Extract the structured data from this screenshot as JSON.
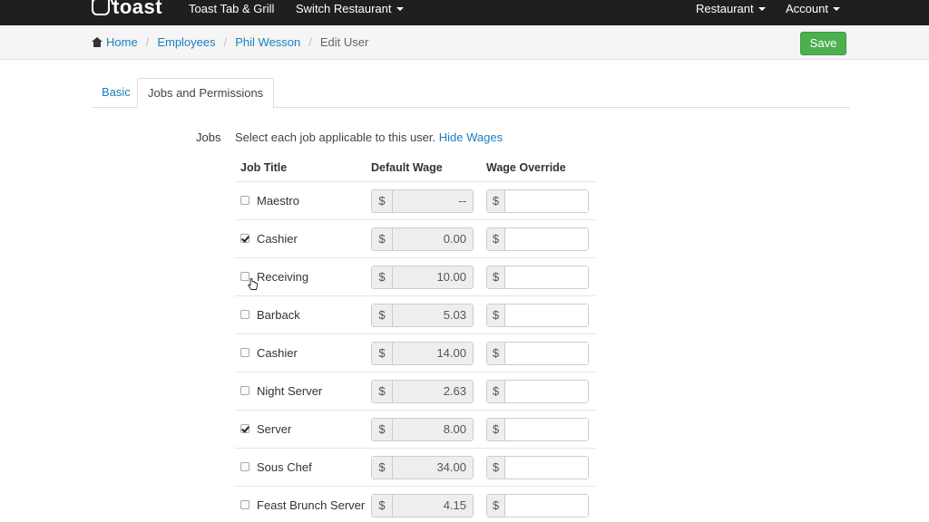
{
  "navbar": {
    "logo_text": "toast",
    "restaurant_name": "Toast Tab & Grill",
    "switch_restaurant": "Switch Restaurant",
    "restaurant_menu": "Restaurant",
    "account_menu": "Account"
  },
  "breadcrumb": {
    "home": "Home",
    "employees": "Employees",
    "employee_name": "Phil Wesson",
    "current": "Edit User",
    "separator": "/"
  },
  "toolbar": {
    "save_label": "Save"
  },
  "tabs": [
    {
      "label": "Basic",
      "active": false
    },
    {
      "label": "Jobs and Permissions",
      "active": true
    }
  ],
  "jobs": {
    "label": "Jobs",
    "help_text": "Select each job applicable to this user.",
    "hide_wages_link": "Hide Wages",
    "columns": {
      "job_title": "Job Title",
      "default_wage": "Default Wage",
      "wage_override": "Wage Override"
    },
    "currency": "$",
    "rows": [
      {
        "title": "Maestro",
        "checked": false,
        "default_wage": "--",
        "override": ""
      },
      {
        "title": "Cashier",
        "checked": true,
        "default_wage": "0.00",
        "override": ""
      },
      {
        "title": "Receiving",
        "checked": false,
        "default_wage": "10.00",
        "override": ""
      },
      {
        "title": "Barback",
        "checked": false,
        "default_wage": "5.03",
        "override": ""
      },
      {
        "title": "Cashier",
        "checked": false,
        "default_wage": "14.00",
        "override": ""
      },
      {
        "title": "Night Server",
        "checked": false,
        "default_wage": "2.63",
        "override": ""
      },
      {
        "title": "Server",
        "checked": true,
        "default_wage": "8.00",
        "override": ""
      },
      {
        "title": "Sous Chef",
        "checked": false,
        "default_wage": "34.00",
        "override": ""
      },
      {
        "title": "Feast Brunch Server",
        "checked": false,
        "default_wage": "4.15",
        "override": ""
      }
    ]
  },
  "colors": {
    "navbar_bg": "#1f1f1f",
    "link": "#1a7fbf",
    "save_button": "#4caf50"
  },
  "icons": {
    "home": "home-icon",
    "caret": "caret-down-icon",
    "checkbox": "checkbox-icon",
    "cursor": "hand-pointer-icon"
  }
}
